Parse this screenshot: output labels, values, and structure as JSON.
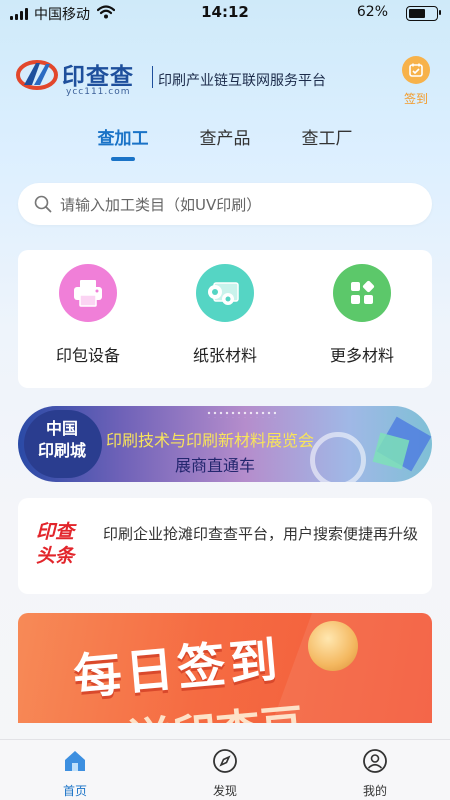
{
  "status_bar": {
    "carrier": "中国移动",
    "time": "14:12",
    "battery_percent": "62%",
    "battery_level": 0.62
  },
  "header": {
    "brand_name": "印查查",
    "brand_domain": "ycc111.com",
    "slogan": "印刷产业链互联网服务平台",
    "signin_label": "签到",
    "brand_color": "#1e4f9c",
    "signin_color": "#f39b2a"
  },
  "tabs": [
    {
      "label": "查加工",
      "active": true
    },
    {
      "label": "查产品",
      "active": false
    },
    {
      "label": "查工厂",
      "active": false
    }
  ],
  "search": {
    "placeholder": "请输入加工类目（如UV印刷）"
  },
  "categories": [
    {
      "label": "印包设备",
      "icon": "printer-icon",
      "color": "#f07fd8"
    },
    {
      "label": "纸张材料",
      "icon": "paper-roll-icon",
      "color": "#55d5c4"
    },
    {
      "label": "更多材料",
      "icon": "grid-more-icon",
      "color": "#5cc86a"
    }
  ],
  "expo_banner": {
    "badge_line1": "中国",
    "badge_line2": "印刷城",
    "title": "印刷技术与印刷新材料展览会",
    "subtitle": "展商直通车"
  },
  "news": {
    "logo_line1": "印查",
    "logo_line2": "头条",
    "text": "印刷企业抢滩印查查平台，用户搜索便捷再升级"
  },
  "checkin_banner": {
    "line1": "每日签到",
    "line2": "送印查豆"
  },
  "bottom_nav": [
    {
      "label": "首页",
      "icon": "home-icon",
      "active": true
    },
    {
      "label": "发现",
      "icon": "compass-icon",
      "active": false
    },
    {
      "label": "我的",
      "icon": "user-icon",
      "active": false
    }
  ],
  "accent_color": "#1a73c7"
}
